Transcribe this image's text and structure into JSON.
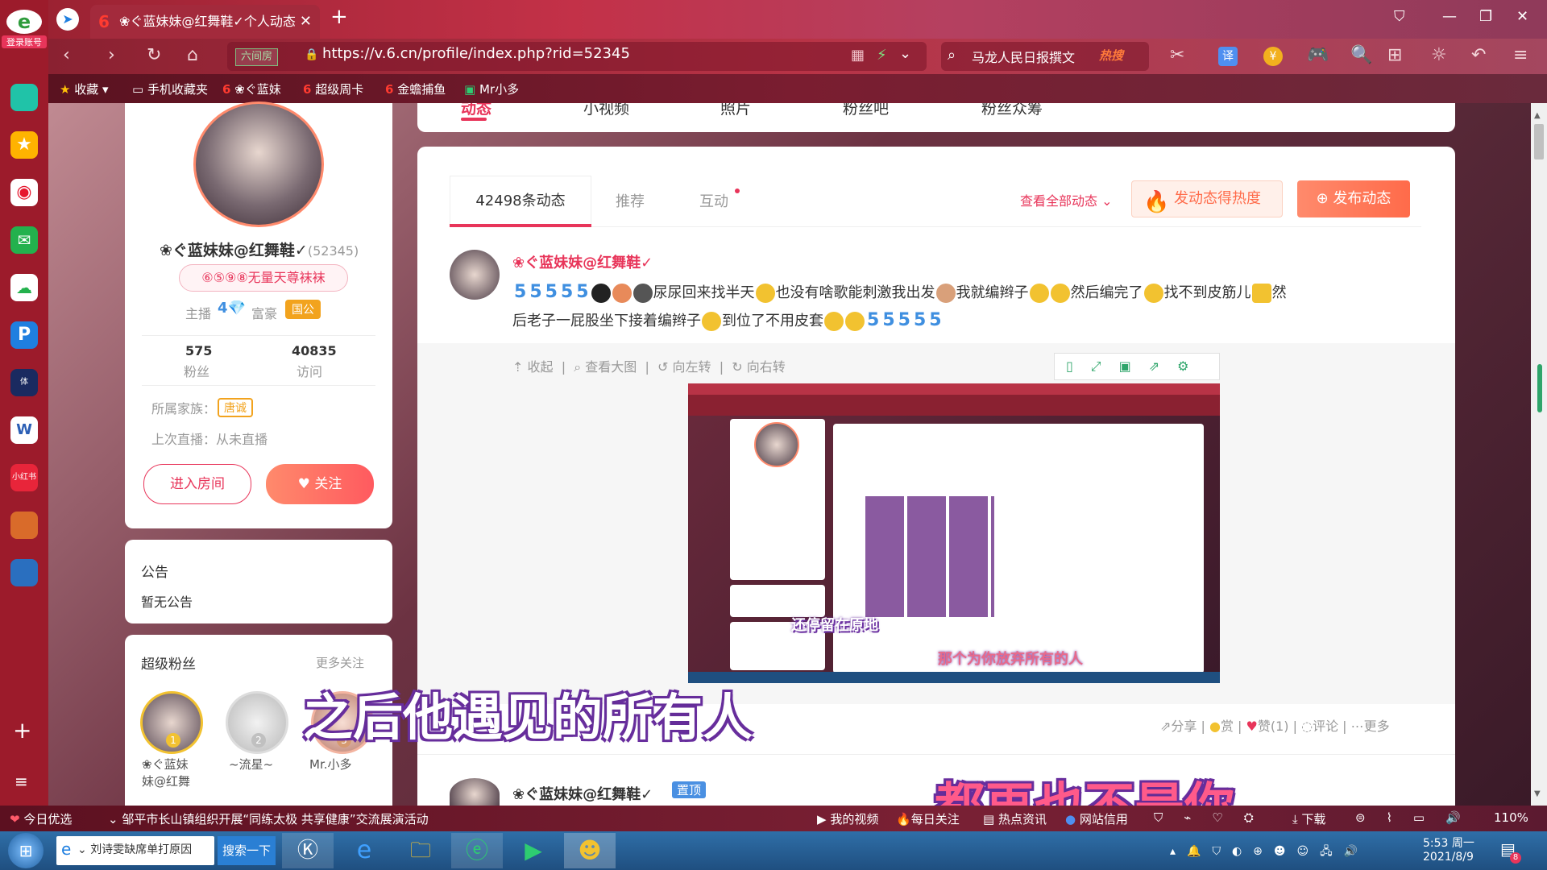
{
  "browser": {
    "tab_title": "❀ぐ蓝妹妹@红舞鞋✓个人动态",
    "url": "https://v.6.cn/profile/index.php?rid=52345",
    "url_badge": "六间房",
    "search_text": "马龙人民日报撰文",
    "search_hot": "热搜",
    "login_badge": "登录账号",
    "bookmarks": [
      "收藏",
      "手机收藏夹",
      "❀ぐ蓝妹",
      "超级周卡",
      "金蟾捕鱼",
      "Mr小多"
    ]
  },
  "profile": {
    "name": "❀ぐ蓝妹妹@红舞鞋✓",
    "rid": "(52345)",
    "badge": "⑥⑤⑨⑧无量天尊袜袜",
    "anchor_label": "主播",
    "rich_label": "富豪",
    "rich_badge": "国公",
    "fans_count": "575",
    "fans_label": "粉丝",
    "visits_count": "40835",
    "visits_label": "访问",
    "family_label": "所属家族：",
    "family_value": "唐诚",
    "last_live": "上次直播：从未直播",
    "enter_room": "进入房间",
    "follow": "关注"
  },
  "notice": {
    "title": "公告",
    "text": "暂无公告"
  },
  "superfans": {
    "title": "超级粉丝",
    "more": "更多关注",
    "fans": [
      {
        "rank": "1",
        "name": "❀ぐ蓝妹\n妹@红舞"
      },
      {
        "rank": "2",
        "name": "~流星~"
      },
      {
        "rank": "3",
        "name": "Mr.小多"
      }
    ]
  },
  "topnav": [
    "动态",
    "小视频",
    "照片",
    "粉丝吧",
    "粉丝众筹"
  ],
  "feed": {
    "tabs": [
      "42498条动态",
      "推荐",
      "互动"
    ],
    "view_all": "查看全部动态",
    "hot_btn": "发动态得热度",
    "publish_btn": "发布动态",
    "post_author": "❀ぐ蓝妹妹@红舞鞋✓",
    "post_text_1": "尿尿回来找半天",
    "post_text_2": "也没有啥歌能刺激我出发",
    "post_text_3": "我就编辫子",
    "post_text_4": "然后编完了",
    "post_text_5": "找不到皮筋儿",
    "post_text_6": "然",
    "post_text_7": "后老子一屁股坐下接着编辫子",
    "post_text_8": "到位了不用皮套",
    "img_tools": [
      "收起",
      "查看大图",
      "向左转",
      "向右转"
    ],
    "actions": [
      "分享",
      "赏",
      "赞(1)",
      "评论",
      "更多"
    ],
    "next_author": "❀ぐ蓝妹妹@红舞鞋✓",
    "pinned": "置顶"
  },
  "subtitles": {
    "inner_1": "还停留在原地",
    "inner_2": "那个为你放弃所有的人",
    "line_1": "之后他遇见的所有人",
    "line_2": "都再也不是你"
  },
  "statusbar": {
    "today": "今日优选",
    "news": "邹平市长山镇组织开展“同练太极 共享健康”交流展演活动",
    "my_video": "我的视频",
    "daily": "每日关注",
    "hot_news": "热点资讯",
    "credit": "网站信用",
    "download": "下载",
    "zoom": "110%"
  },
  "taskbar": {
    "search_text": "刘诗雯缺席单打原因",
    "search_btn": "搜索一下",
    "time": "5:53 周一",
    "date": "2021/8/9",
    "notif_count": "8"
  },
  "colors": {
    "accent": "#e8355a",
    "orange": "#ff6b4a",
    "titlebar": "#b83346"
  }
}
